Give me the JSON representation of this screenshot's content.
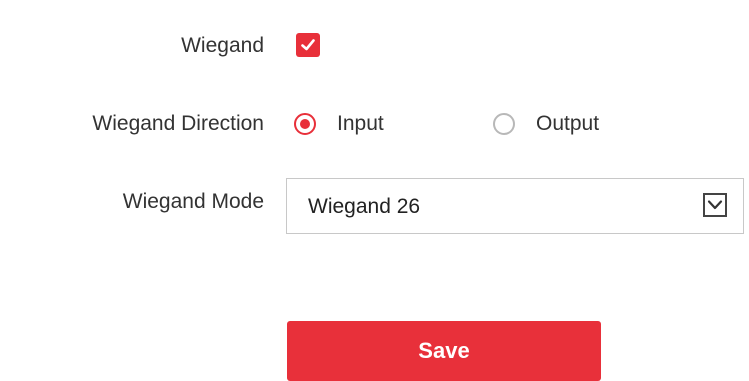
{
  "form": {
    "wiegand": {
      "label": "Wiegand",
      "checked": true
    },
    "direction": {
      "label": "Wiegand Direction",
      "options": [
        {
          "label": "Input",
          "selected": true
        },
        {
          "label": "Output",
          "selected": false
        }
      ]
    },
    "mode": {
      "label": "Wiegand Mode",
      "value": "Wiegand 26"
    },
    "save_label": "Save"
  },
  "colors": {
    "accent": "#e8303a",
    "text": "#333333",
    "border": "#c8c8c8"
  },
  "icons": {
    "checkbox": "checkmark-icon",
    "dropdown": "chevron-down-icon"
  }
}
